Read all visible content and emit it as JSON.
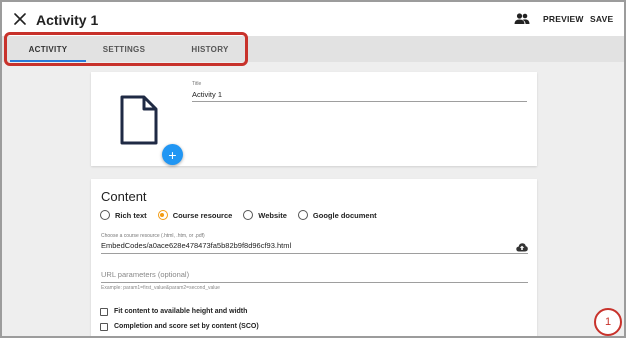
{
  "header": {
    "title": "Activity 1",
    "preview_label": "PREVIEW",
    "save_label": "SAVE"
  },
  "tabs": [
    {
      "label": "ACTIVITY",
      "active": true
    },
    {
      "label": "SETTINGS",
      "active": false
    },
    {
      "label": "HISTORY",
      "active": false
    }
  ],
  "resource": {
    "title_label": "Title",
    "title_value": "Activity 1",
    "add_button": "+"
  },
  "content": {
    "heading": "Content",
    "options": [
      {
        "label": "Rich text",
        "selected": false
      },
      {
        "label": "Course resource",
        "selected": true
      },
      {
        "label": "Website",
        "selected": false
      },
      {
        "label": "Google document",
        "selected": false
      }
    ],
    "resource_label": "Choose a course resource (.html, .htm, or .pdf)",
    "resource_value": "EmbedCodes/a0ace628e478473fa5b82b9f8d96cf93.html",
    "url_placeholder": "URL parameters (optional)",
    "url_hint": "Example: param1=first_value&param2=second_value",
    "checkboxes": [
      {
        "label": "Fit content to available height and width",
        "checked": false
      },
      {
        "label": "Completion and score set by content (SCO)",
        "checked": false
      }
    ]
  },
  "annotation": {
    "step": "1"
  },
  "colors": {
    "accent": "#2196f3",
    "tab_underline": "#2a7ad8",
    "radio_selected": "#f39c12",
    "annotation": "#c8322b"
  }
}
